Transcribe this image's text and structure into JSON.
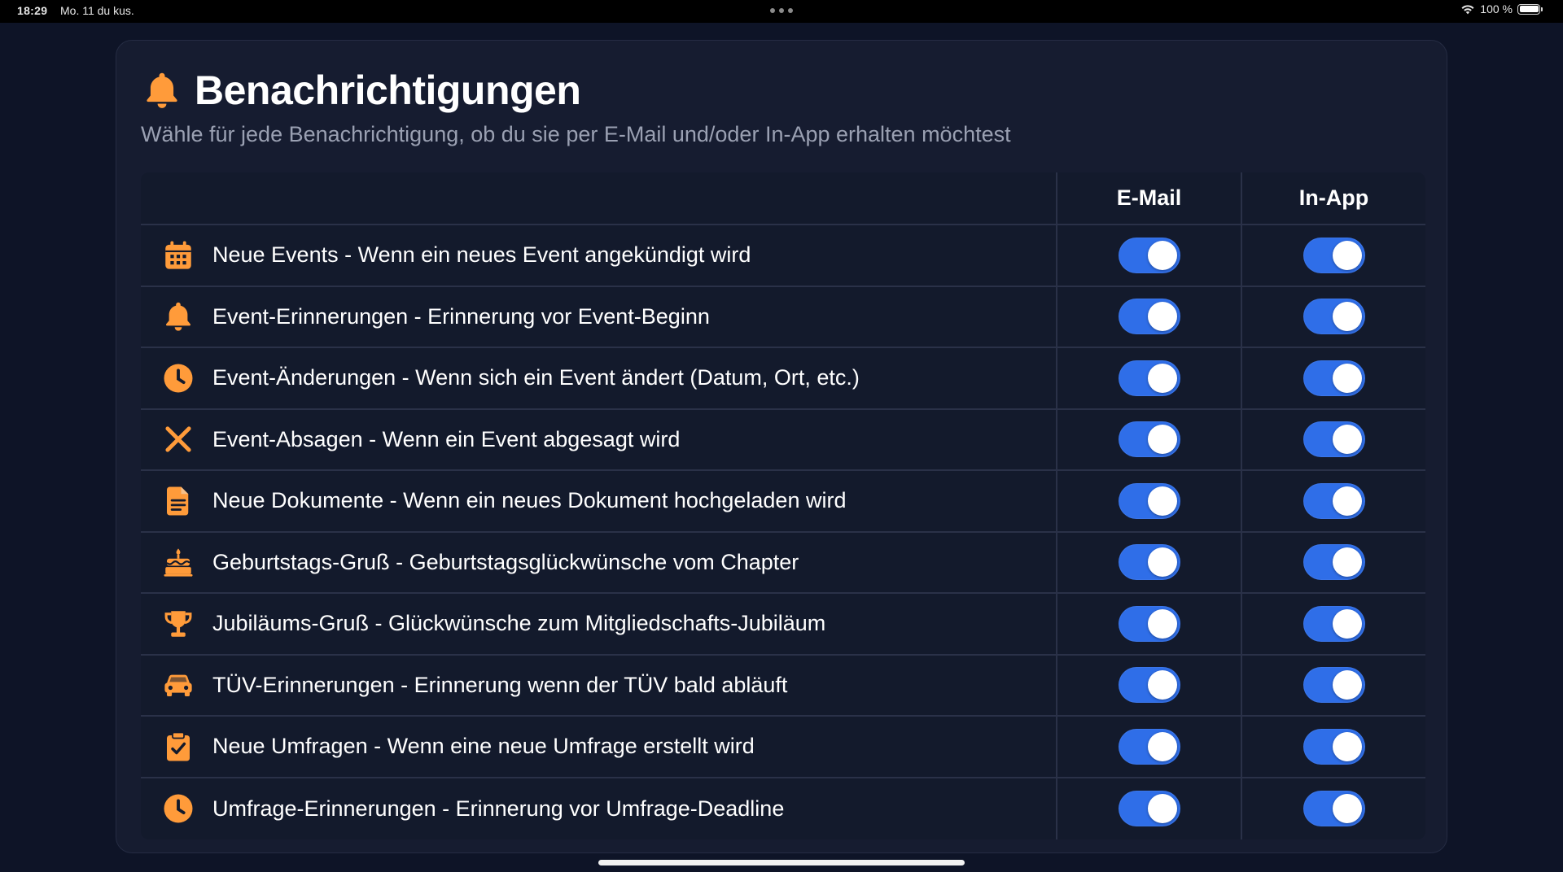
{
  "status_bar": {
    "time": "18:29",
    "date": "Mo. 11 du kus.",
    "battery": "100 %"
  },
  "header": {
    "title": "Benachrichtigungen",
    "subtitle": "Wähle für jede Benachrichtigung, ob du sie per E-Mail und/oder In-App erhalten möchtest",
    "icon": "bell-icon"
  },
  "table": {
    "columns": [
      "",
      "E-Mail",
      "In-App"
    ],
    "rows": [
      {
        "icon": "calendar-icon",
        "label": "Neue Events - Wenn ein neues Event angekündigt wird",
        "email": true,
        "inapp": true
      },
      {
        "icon": "bell-icon",
        "label": "Event-Erinnerungen - Erinnerung vor Event-Beginn",
        "email": true,
        "inapp": true
      },
      {
        "icon": "clock-icon",
        "label": "Event-Änderungen - Wenn sich ein Event ändert (Datum, Ort, etc.)",
        "email": true,
        "inapp": true
      },
      {
        "icon": "x-icon",
        "label": "Event-Absagen - Wenn ein Event abgesagt wird",
        "email": true,
        "inapp": true
      },
      {
        "icon": "document-icon",
        "label": "Neue Dokumente - Wenn ein neues Dokument hochgeladen wird",
        "email": true,
        "inapp": true
      },
      {
        "icon": "cake-icon",
        "label": "Geburtstags-Gruß - Geburtstagsglückwünsche vom Chapter",
        "email": true,
        "inapp": true
      },
      {
        "icon": "trophy-icon",
        "label": "Jubiläums-Gruß - Glückwünsche zum Mitgliedschafts-Jubiläum",
        "email": true,
        "inapp": true
      },
      {
        "icon": "car-icon",
        "label": "TÜV-Erinnerungen - Erinnerung wenn der TÜV bald abläuft",
        "email": true,
        "inapp": true
      },
      {
        "icon": "clipboard-check-icon",
        "label": "Neue Umfragen - Wenn eine neue Umfrage erstellt wird",
        "email": true,
        "inapp": true
      },
      {
        "icon": "clock-icon",
        "label": "Umfrage-Erinnerungen - Erinnerung vor Umfrage-Deadline",
        "email": true,
        "inapp": true
      }
    ]
  },
  "colors": {
    "background": "#0e1427",
    "card": "#161c30",
    "accent_orange": "#ff9b3a",
    "toggle_on": "#2f6ee8",
    "subtitle_text": "#9aa0b2"
  }
}
